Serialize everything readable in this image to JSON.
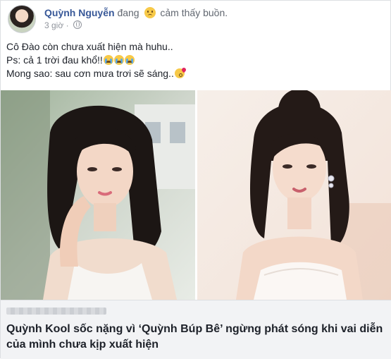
{
  "post": {
    "author": "Quỳnh Nguyễn",
    "feeling_prefix": "đang",
    "feeling_icon": "sad-face-emoji",
    "feeling": "cảm thấy buồn.",
    "time": "3 giờ",
    "privacy_icon": "globe-icon",
    "lines": [
      "Cô Đào còn chưa xuất hiện mà huhu..",
      "Ps: cả 1 trời đau khổ!!",
      "Mong sao: sau cơn mưa trơi sẽ sáng.."
    ],
    "line_emojis": [
      [],
      [
        "crying-face-emoji",
        "crying-face-emoji",
        "crying-face-emoji"
      ],
      [
        "kiss-face-emoji"
      ]
    ]
  },
  "link_preview": {
    "title": "Quỳnh Kool sốc nặng vì ‘Quỳnh Búp Bê’ ngừng phát sóng khi vai diễn của mình chưa kịp xuất hiện"
  },
  "colors": {
    "author_link": "#385898",
    "secondary_text": "#90949c",
    "link_bg": "#f2f3f5"
  }
}
